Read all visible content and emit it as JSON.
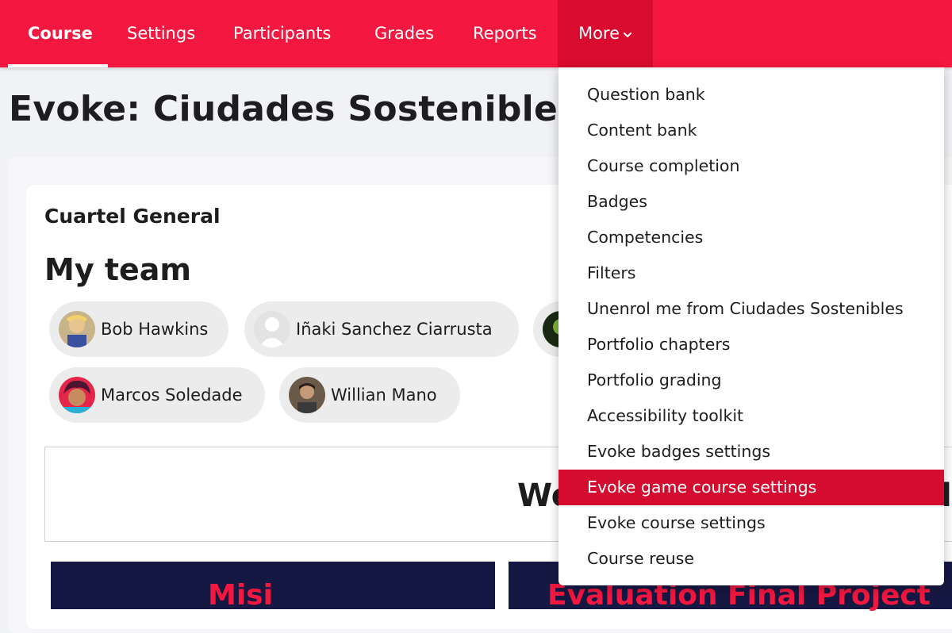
{
  "nav": {
    "tabs": [
      {
        "label": "Course",
        "active": true
      },
      {
        "label": "Settings"
      },
      {
        "label": "Participants"
      },
      {
        "label": "Grades"
      },
      {
        "label": "Reports"
      }
    ],
    "more_label": "More"
  },
  "page_title": "Evoke: Ciudades Sostenibles Ho",
  "section_title": "Cuartel General",
  "team": {
    "heading": "My team",
    "members": [
      {
        "name": "Bob Hawkins"
      },
      {
        "name": "Iñaki Sanchez Ciarrusta"
      },
      {
        "name": "Marcos Soledade"
      },
      {
        "name": "Willian Mano"
      }
    ]
  },
  "welcome_partial": "We",
  "welcome_partial_right": "l",
  "mission_partial": "Misi",
  "final_partial": "Evaluation Final Project",
  "dropdown": {
    "items": [
      "Question bank",
      "Content bank",
      "Course completion",
      "Badges",
      "Competencies",
      "Filters",
      "Unenrol me from Ciudades Sostenibles",
      "Portfolio chapters",
      "Portfolio grading",
      "Accessibility toolkit",
      "Evoke badges settings",
      "Evoke game course settings",
      "Evoke course settings",
      "Course reuse"
    ],
    "highlighted": "Evoke game course settings"
  },
  "colors": {
    "brand": "#f4173f",
    "more_tab_bg": "#d90b2f",
    "highlight": "#d40c30",
    "mission_bg": "#161844"
  }
}
